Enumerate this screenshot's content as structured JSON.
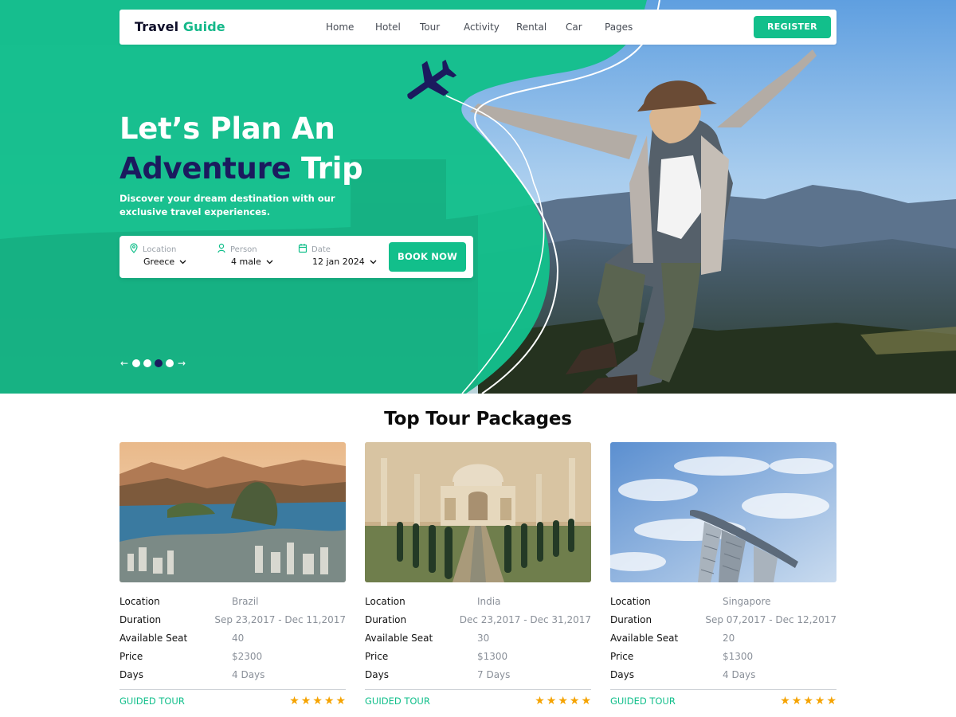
{
  "nav": {
    "logo_part1": "Travel",
    "logo_part2": "Guide",
    "items": [
      {
        "label": "Home"
      },
      {
        "label": "Hotel"
      },
      {
        "label": "Tour"
      },
      {
        "label": "Activity"
      },
      {
        "label": "Rental"
      },
      {
        "label": "Car"
      },
      {
        "label": "Pages"
      }
    ],
    "register_label": "REGISTER"
  },
  "hero": {
    "line1": "Let’s Plan An",
    "line2_accent": "Adventure",
    "line2_rest": "Trip",
    "subtitle": "Discover your dream destination with our exclusive travel experiences."
  },
  "booking": {
    "location": {
      "label": "Location",
      "value": "Greece",
      "icon": "location-pin-icon"
    },
    "person": {
      "label": "Person",
      "value": "4 male",
      "icon": "person-icon"
    },
    "date": {
      "label": "Date",
      "value": "12 jan 2024",
      "icon": "calendar-icon"
    },
    "button_label": "BOOK NOW"
  },
  "slider": {
    "prev": "←",
    "next": "→",
    "active_index": 2,
    "count": 4
  },
  "section": {
    "title": "Top Tour Packages"
  },
  "labels": {
    "location": "Location",
    "duration": "Duration",
    "seat": "Available Seat",
    "price": "Price",
    "days": "Days"
  },
  "packages": [
    {
      "location": "Brazil",
      "duration": "Sep 23,2017 - Dec 11,2017",
      "seat": "40",
      "price": "$2300",
      "days": "4 Days",
      "tag": "GUIDED TOUR",
      "rating": 5
    },
    {
      "location": "India",
      "duration": "Dec 23,2017 - Dec 31,2017",
      "seat": "30",
      "price": "$1300",
      "days": "7 Days",
      "tag": "GUIDED TOUR",
      "rating": 5
    },
    {
      "location": "Singapore",
      "duration": "Sep 07,2017 - Dec 12,2017",
      "seat": "20",
      "price": "$1300",
      "days": "4 Days",
      "tag": "GUIDED TOUR",
      "rating": 5
    }
  ],
  "colors": {
    "accent": "#12bf8b",
    "dark": "#1b1a5e",
    "star": "#f5a300"
  }
}
